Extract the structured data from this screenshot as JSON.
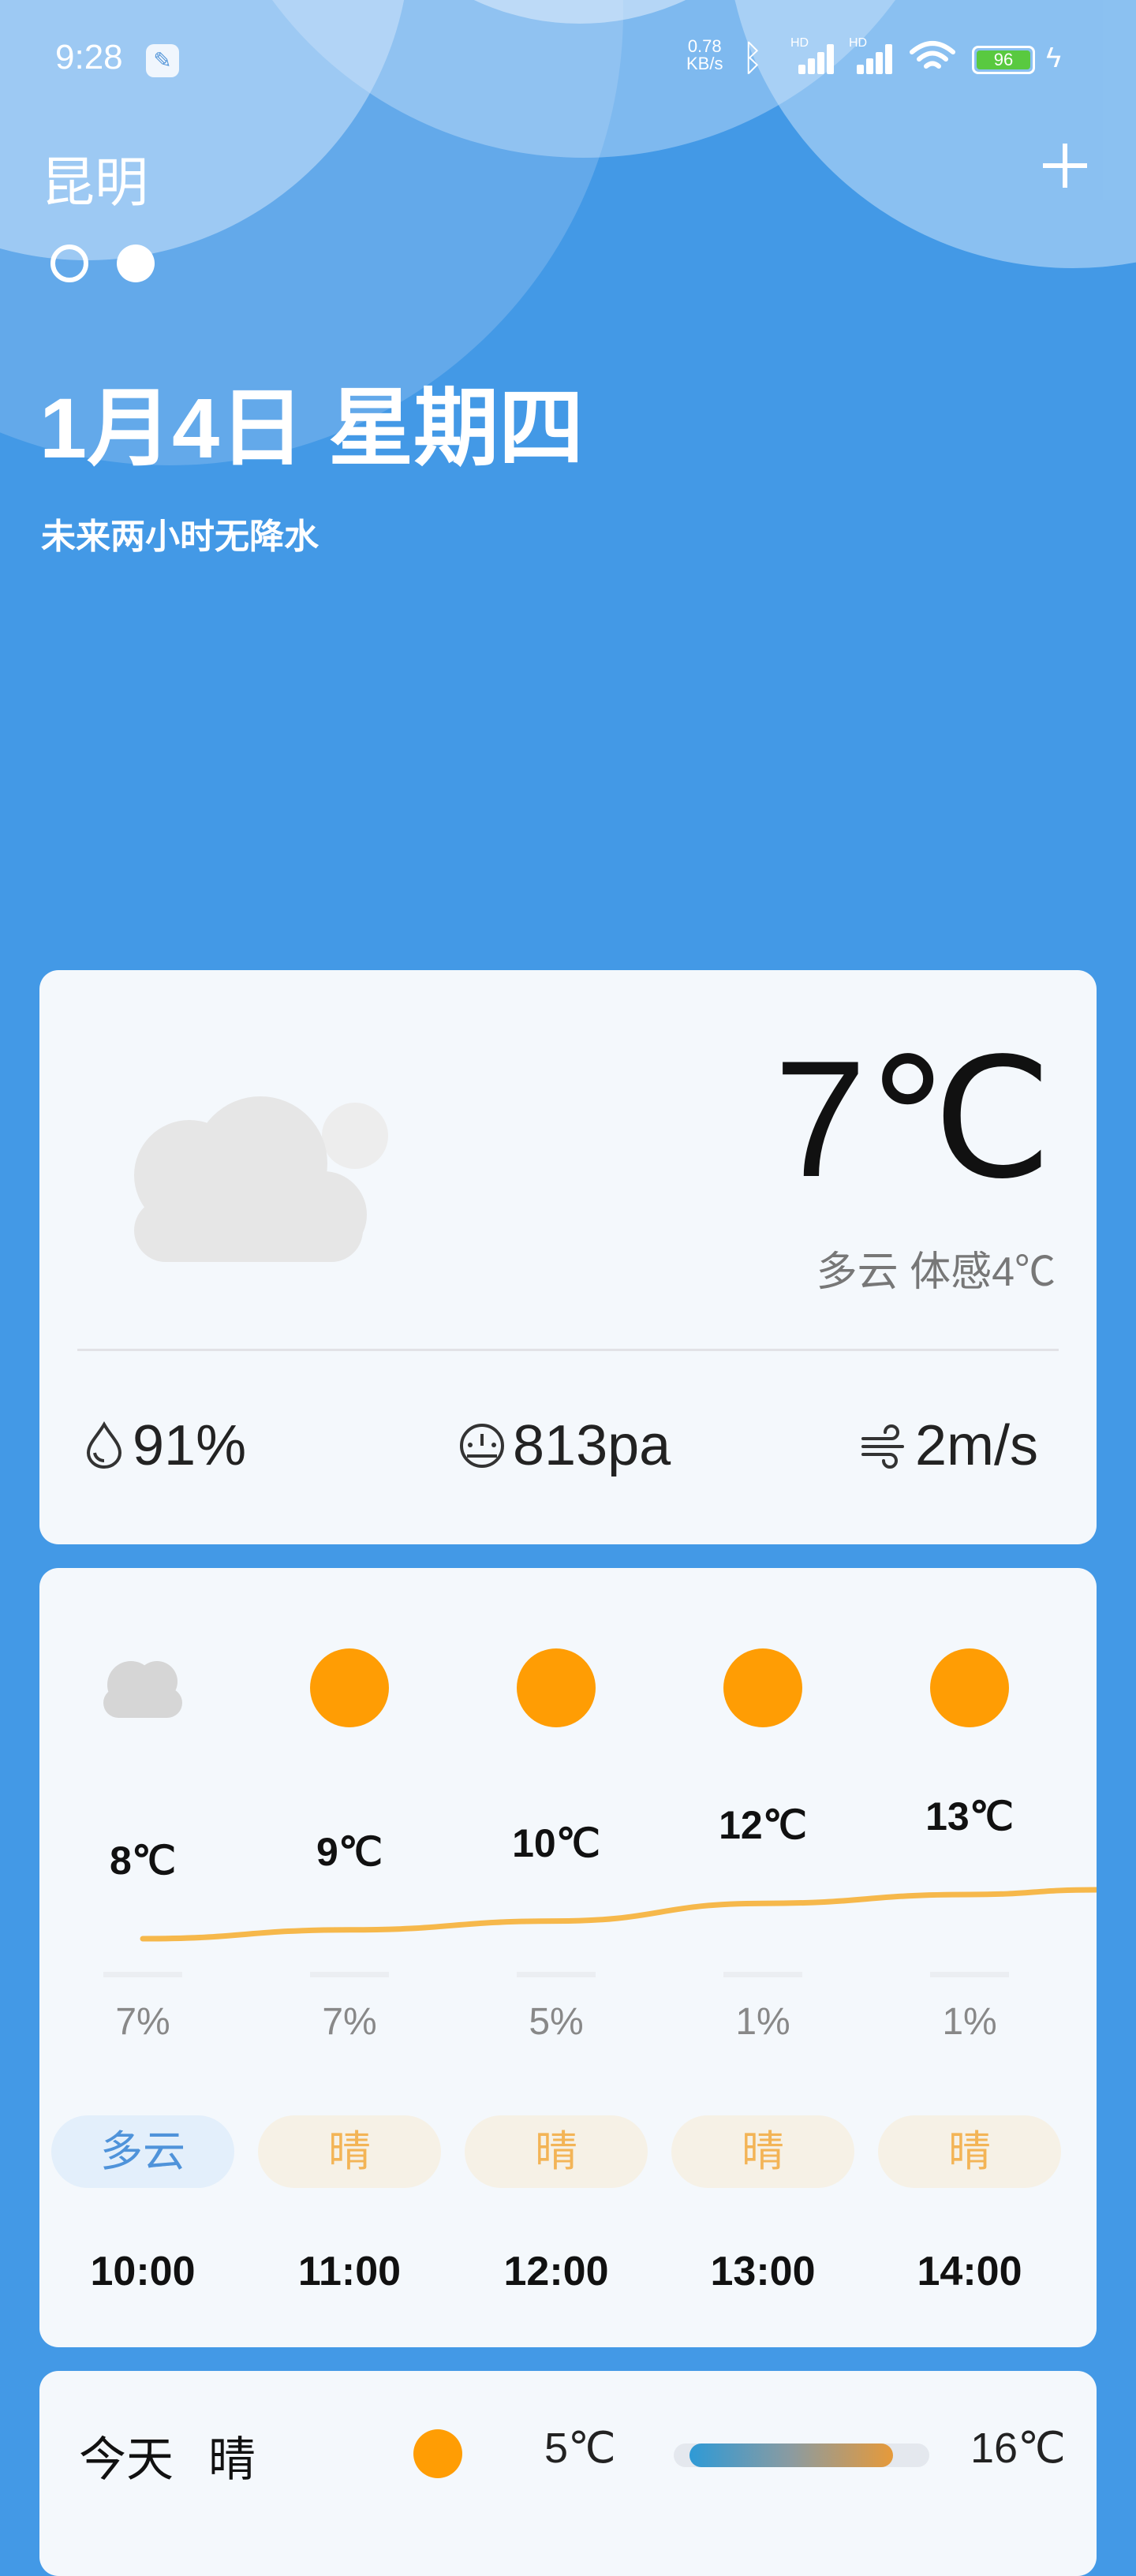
{
  "status_bar": {
    "time": "9:28",
    "net_speed_value": "0.78",
    "net_speed_unit": "KB/s",
    "signal_1_label": "HD",
    "signal_2_label": "HD",
    "battery_level": "96",
    "icons": [
      "wrench-icon",
      "bluetooth-icon",
      "signal-icon",
      "signal-icon",
      "wifi-icon",
      "battery-icon",
      "charging-icon"
    ]
  },
  "header": {
    "city": "昆明",
    "add_icon": "plus-icon",
    "page_count": 2,
    "active_page": 2
  },
  "today": {
    "date": "1月4日 星期四",
    "precip_note": "未来两小时无降水"
  },
  "current": {
    "icon": "cloud-icon",
    "temperature": "7℃",
    "description": "多云 体感4℃",
    "humidity": "91%",
    "pressure": "813pa",
    "wind": "2m/s"
  },
  "hourly": [
    {
      "time": "10:00",
      "temp": "8℃",
      "precip": "7%",
      "condition": "多云",
      "icon": "cloud-icon"
    },
    {
      "time": "11:00",
      "temp": "9℃",
      "precip": "7%",
      "condition": "晴",
      "icon": "sun-icon"
    },
    {
      "time": "12:00",
      "temp": "10℃",
      "precip": "5%",
      "condition": "晴",
      "icon": "sun-icon"
    },
    {
      "time": "13:00",
      "temp": "12℃",
      "precip": "1%",
      "condition": "晴",
      "icon": "sun-icon"
    },
    {
      "time": "14:00",
      "temp": "13℃",
      "precip": "1%",
      "condition": "晴",
      "icon": "sun-icon"
    }
  ],
  "forecast": [
    {
      "day": "今天",
      "condition": "晴",
      "icon": "sun-icon",
      "low": "5℃",
      "high": "16℃"
    }
  ],
  "colors": {
    "background": "#4399E6",
    "card": "#F4F8FC",
    "sun": "#FF9D04",
    "cloud_pill_text": "#4F93DA",
    "sun_pill_text": "#F3B456",
    "temp_curve": "#F6B84B"
  }
}
